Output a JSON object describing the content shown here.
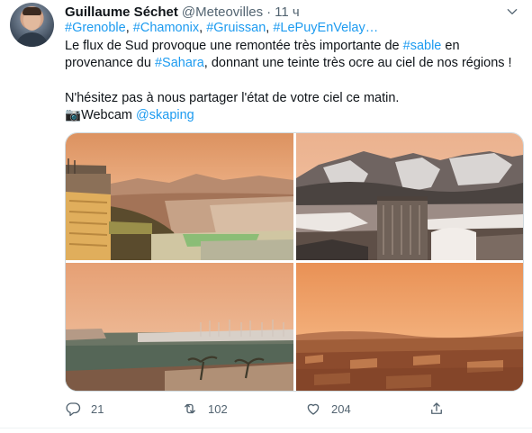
{
  "tweet": {
    "author_name": "Guillaume Séchet",
    "handle": "@Meteovilles",
    "separator": "·",
    "time": "11 ч",
    "hashtags": [
      "#Grenoble",
      "#Chamonix",
      "#Gruissan",
      "#LePuyEnVelay…"
    ],
    "line2": {
      "before": "Le flux de Sud provoque une remontée très importante de ",
      "tag": "#sable",
      "after": " en"
    },
    "line3": {
      "before": "provenance du ",
      "tag": "#Sahara",
      "after": ", donnant une teinte très ocre au ciel de nos régions !"
    },
    "line4": "N'hésitez pas à nous partager l'état de votre ciel ce matin.",
    "line5": {
      "icon": "📷",
      "label": "Webcam ",
      "tag": "@skaping"
    }
  },
  "media": [
    {
      "name": "grenoble-webcam-image",
      "icon": "photo"
    },
    {
      "name": "chamonix-webcam-image",
      "icon": "photo"
    },
    {
      "name": "gruissan-webcam-image",
      "icon": "photo"
    },
    {
      "name": "le-puy-webcam-image",
      "icon": "photo"
    }
  ],
  "actions": {
    "reply_count": "21",
    "retweet_count": "102",
    "like_count": "204"
  },
  "colors": {
    "link": "#1d9bf0",
    "secondary_text": "#536471",
    "sky_orange": "#e9a06a"
  }
}
